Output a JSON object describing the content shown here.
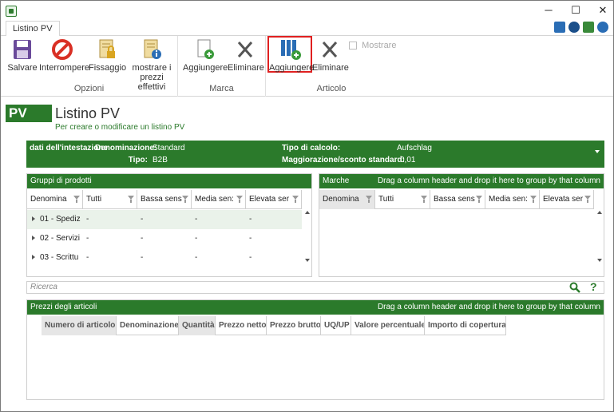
{
  "window": {
    "minimize": "─",
    "maximize": "☐",
    "close": "✕"
  },
  "tabs": [
    {
      "label": "Listino PV"
    }
  ],
  "ribbon": {
    "groups": [
      {
        "label": "Opzioni"
      },
      {
        "label": "Marca"
      },
      {
        "label": "Articolo"
      }
    ],
    "buttons": {
      "salvare": "Salvare",
      "interrompere": "Interrompere",
      "fissaggio": "Fissaggio",
      "mostrare_prezzi_1": "mostrare i",
      "mostrare_prezzi_2": "prezzi effettivi",
      "marca_aggiungere": "Aggiungere",
      "marca_eliminare": "Eliminare",
      "articolo_aggiungere": "Aggiungere",
      "articolo_eliminare": "Eliminare",
      "mostrare": "Mostrare"
    }
  },
  "header": {
    "badge": "PV",
    "title": "Listino PV",
    "subtitle": "Per creare o modificare un listino PV"
  },
  "info": {
    "section": "dati dell'intestazione",
    "denominazione_label": "Denominazione:",
    "denominazione_value": "Standard",
    "tipo_label": "Tipo:",
    "tipo_value": "B2B",
    "calcolo_label": "Tipo di calcolo:",
    "calcolo_value": "Aufschlag",
    "maggiorazione_label": "Maggiorazione/sconto standard:",
    "maggiorazione_value": "0,01"
  },
  "gruppi": {
    "title": "Gruppi di prodotti",
    "columns": [
      "Denomina",
      "Tutti",
      "Bassa sens",
      "Media sen:",
      "Elevata ser"
    ],
    "rows": [
      {
        "name": "01 - Spediz",
        "v1": "-",
        "v2": "-",
        "v3": "-",
        "v4": "-"
      },
      {
        "name": "02 - Servizi",
        "v1": "-",
        "v2": "-",
        "v3": "-",
        "v4": "-"
      },
      {
        "name": "03 - Scrittu",
        "v1": "-",
        "v2": "-",
        "v3": "-",
        "v4": "-"
      }
    ]
  },
  "marche": {
    "title": "Marche",
    "hint": "Drag a column header and drop it here to group by that column",
    "columns": [
      "Denomina",
      "Tutti",
      "Bassa sens",
      "Media sen:",
      "Elevata ser"
    ]
  },
  "search": {
    "placeholder": "Ricerca"
  },
  "articoli": {
    "title": "Prezzi degli articoli",
    "hint": "Drag a column header and drop it here to group by that column",
    "columns": [
      "Numero di articolo",
      "Denominazione",
      "Quantità",
      "Prezzo netto",
      "Prezzo brutto",
      "UQ/UP",
      "Valore percentuale",
      "Importo di copertura"
    ]
  },
  "colors": {
    "brand": "#2b7a2b",
    "selection": "#e02020"
  }
}
